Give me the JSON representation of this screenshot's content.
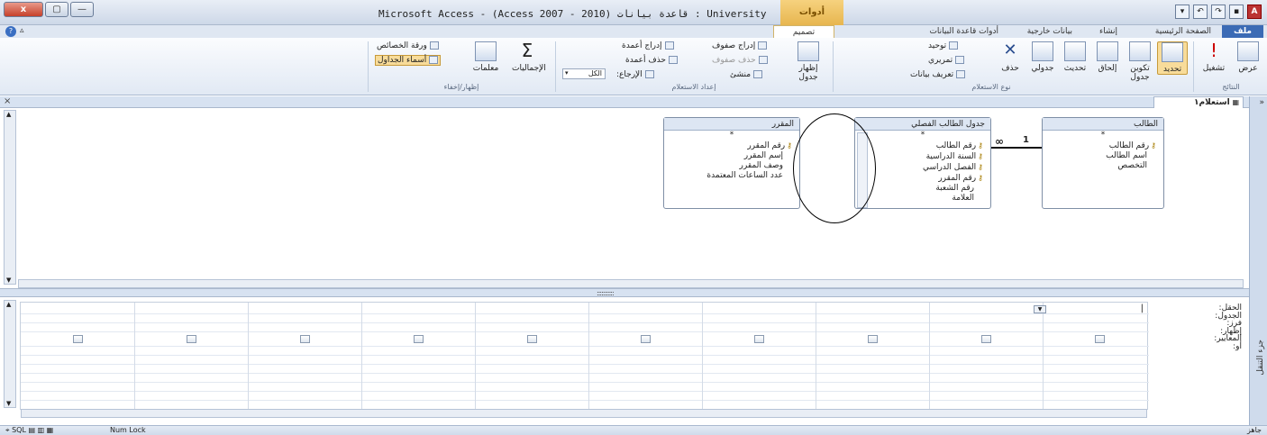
{
  "window": {
    "title": "Microsoft Access - (Access 2007 - 2010) قاعدة بيانات : University",
    "context_tab_title": "أدوات الاستعلام",
    "close_label": "x",
    "max_label": "▢",
    "min_label": "—"
  },
  "quick_access": {
    "app_icon": "A"
  },
  "ribbon_tabs": {
    "file": "ملف",
    "home": "الصفحة الرئيسية",
    "create": "إنشاء",
    "external": "بيانات خارجية",
    "dbtools": "أدوات قاعدة البيانات",
    "design": "تصميم"
  },
  "ribbon": {
    "results": {
      "label": "النتائج",
      "view": "عرض",
      "run": "تشغيل"
    },
    "query_type": {
      "label": "نوع الاستعلام",
      "select": "تحديد",
      "make_table": "تكوين جدول",
      "append": "إلحاق",
      "update": "تحديث",
      "crosstab": "جدولي",
      "delete": "حذف",
      "union": "توحيد",
      "pass_through": "تمريري",
      "data_definition": "تعريف بيانات"
    },
    "query_setup": {
      "label": "إعداد الاستعلام",
      "show_table": "إظهار جدول",
      "insert_rows": "إدراج صفوف",
      "delete_rows": "حذف صفوف",
      "builder": "منشئ",
      "insert_columns": "إدراج أعمدة",
      "delete_columns": "حذف أعمدة",
      "return_label": "الإرجاع:",
      "return_value": "الكل"
    },
    "show_hide": {
      "label": "إظهار/إخفاء",
      "totals": "الإجماليات",
      "parameters": "معلمات",
      "property_sheet": "ورقة الخصائص",
      "table_names": "أسماء الجداول"
    }
  },
  "query_tab": {
    "label": "استعلام١"
  },
  "nav_pane": {
    "label": "جزء التنقل",
    "collapse": "»"
  },
  "tables": [
    {
      "title": "الطالب",
      "star": "*",
      "fields": [
        {
          "name": "رقم الطالب",
          "key": true
        },
        {
          "name": "اسم الطالب",
          "key": false
        },
        {
          "name": "التخصص",
          "key": false
        }
      ]
    },
    {
      "title": "جدول الطالب الفصلي",
      "star": "*",
      "fields": [
        {
          "name": "رقم الطالب",
          "key": true
        },
        {
          "name": "السنة الدراسية",
          "key": true
        },
        {
          "name": "الفصل الدراسي",
          "key": true
        },
        {
          "name": "رقم المقرر",
          "key": true
        },
        {
          "name": "رقم الشعبة",
          "key": false
        },
        {
          "name": "العلامة",
          "key": false
        }
      ]
    },
    {
      "title": "المقرر",
      "star": "*",
      "fields": [
        {
          "name": "رقم المقرر",
          "key": true
        },
        {
          "name": "إسم المقرر",
          "key": false
        },
        {
          "name": "وصف المقرر",
          "key": false
        },
        {
          "name": "عدد الساعات المعتمدة",
          "key": false
        }
      ]
    }
  ],
  "relationship": {
    "many": "∞",
    "one": "1"
  },
  "grid": {
    "row_labels": [
      "الحقل:",
      "الجدول:",
      "فرز:",
      "إظهار:",
      "المعايير:",
      "أو:"
    ],
    "first_field_value": "|",
    "columns": 10
  },
  "status": {
    "ready": "جاهز",
    "num_lock": "Num Lock",
    "view_icons": "SQL"
  }
}
